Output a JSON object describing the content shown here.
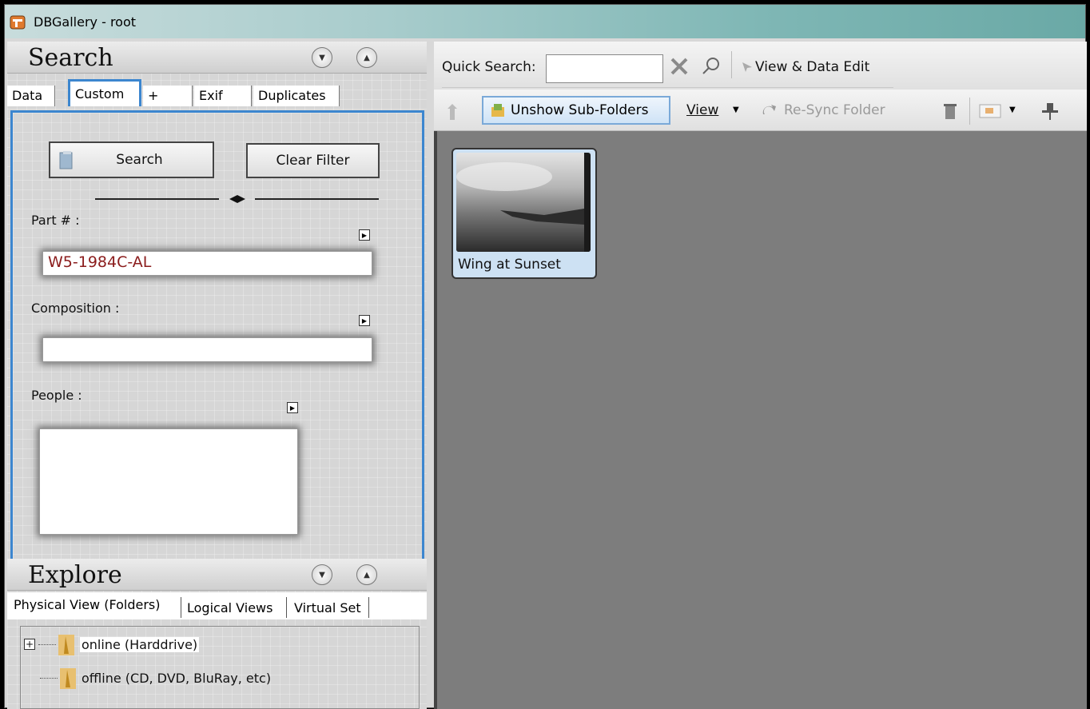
{
  "window": {
    "title": "DBGallery - root"
  },
  "search": {
    "title": "Search",
    "tabs": [
      "Data",
      "Custom",
      "+",
      "Exif",
      "Duplicates"
    ],
    "search_button": "Search",
    "clear_button": "Clear Filter",
    "fields": [
      {
        "label": "Part # :",
        "value": "W5-1984C-AL"
      },
      {
        "label": "Composition :",
        "value": ""
      },
      {
        "label": "People :",
        "value": ""
      }
    ]
  },
  "explore": {
    "title": "Explore",
    "tabs": [
      "Physical View (Folders)",
      "Logical Views",
      "Virtual Set"
    ],
    "tree": [
      {
        "label": "online (Harddrive)",
        "expander": "+"
      },
      {
        "label": "offline (CD, DVD, BluRay, etc)"
      }
    ]
  },
  "toolbar": {
    "quick_search_label": "Quick Search:",
    "quick_search_value": "",
    "view_data_edit": "View & Data Edit",
    "unshow_subfolders": "Unshow Sub-Folders",
    "view": "View",
    "resync": "Re-Sync Folder"
  },
  "gallery": {
    "items": [
      {
        "label": "Wing at Sunset"
      }
    ]
  },
  "colors": {
    "accent": "#3c86cf",
    "gallery_bg": "#7d7d7d",
    "field_text": "#8b1c1c"
  }
}
